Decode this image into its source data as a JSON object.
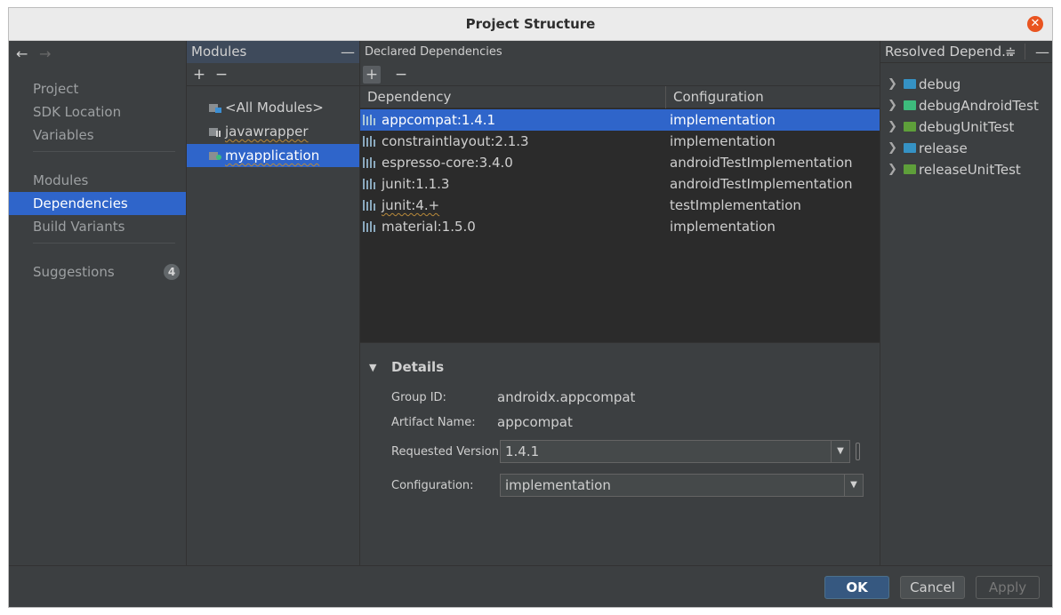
{
  "window": {
    "title": "Project Structure"
  },
  "nav": {
    "items": [
      {
        "label": "Project"
      },
      {
        "label": "SDK Location"
      },
      {
        "label": "Variables"
      },
      {
        "label": "Modules"
      },
      {
        "label": "Dependencies"
      },
      {
        "label": "Build Variants"
      },
      {
        "label": "Suggestions",
        "badge": "4"
      }
    ],
    "selected": "Dependencies"
  },
  "modules": {
    "header": "Modules",
    "items": [
      {
        "label": "<All Modules>"
      },
      {
        "label": "javawrapper"
      },
      {
        "label": "myapplication"
      }
    ],
    "selected": "myapplication"
  },
  "declared": {
    "header": "Declared Dependencies",
    "columns": {
      "dependency": "Dependency",
      "configuration": "Configuration"
    },
    "rows": [
      {
        "name": "appcompat:1.4.1",
        "configuration": "implementation"
      },
      {
        "name": "constraintlayout:2.1.3",
        "configuration": "implementation"
      },
      {
        "name": "espresso-core:3.4.0",
        "configuration": "androidTestImplementation"
      },
      {
        "name": "junit:1.1.3",
        "configuration": "androidTestImplementation"
      },
      {
        "name": "junit:4.+",
        "configuration": "testImplementation"
      },
      {
        "name": "material:1.5.0",
        "configuration": "implementation"
      }
    ],
    "selected": "appcompat:1.4.1"
  },
  "details": {
    "title": "Details",
    "group_id_label": "Group ID:",
    "group_id": "androidx.appcompat",
    "artifact_label": "Artifact Name:",
    "artifact": "appcompat",
    "requested_version_label": "Requested Version:",
    "requested_version": "1.4.1",
    "configuration_label": "Configuration:",
    "configuration": "implementation"
  },
  "resolved": {
    "header": "Resolved Depend...",
    "items": [
      {
        "label": "debug",
        "color": "#3592c4"
      },
      {
        "label": "debugAndroidTest",
        "color": "#3dbb7c"
      },
      {
        "label": "debugUnitTest",
        "color": "#5e9f3a"
      },
      {
        "label": "release",
        "color": "#3592c4"
      },
      {
        "label": "releaseUnitTest",
        "color": "#5e9f3a"
      }
    ]
  },
  "footer": {
    "ok": "OK",
    "cancel": "Cancel",
    "apply": "Apply"
  },
  "colors": {
    "selection": "#2f65ca",
    "background": "#3c3f41",
    "accent_close": "#e95420"
  }
}
